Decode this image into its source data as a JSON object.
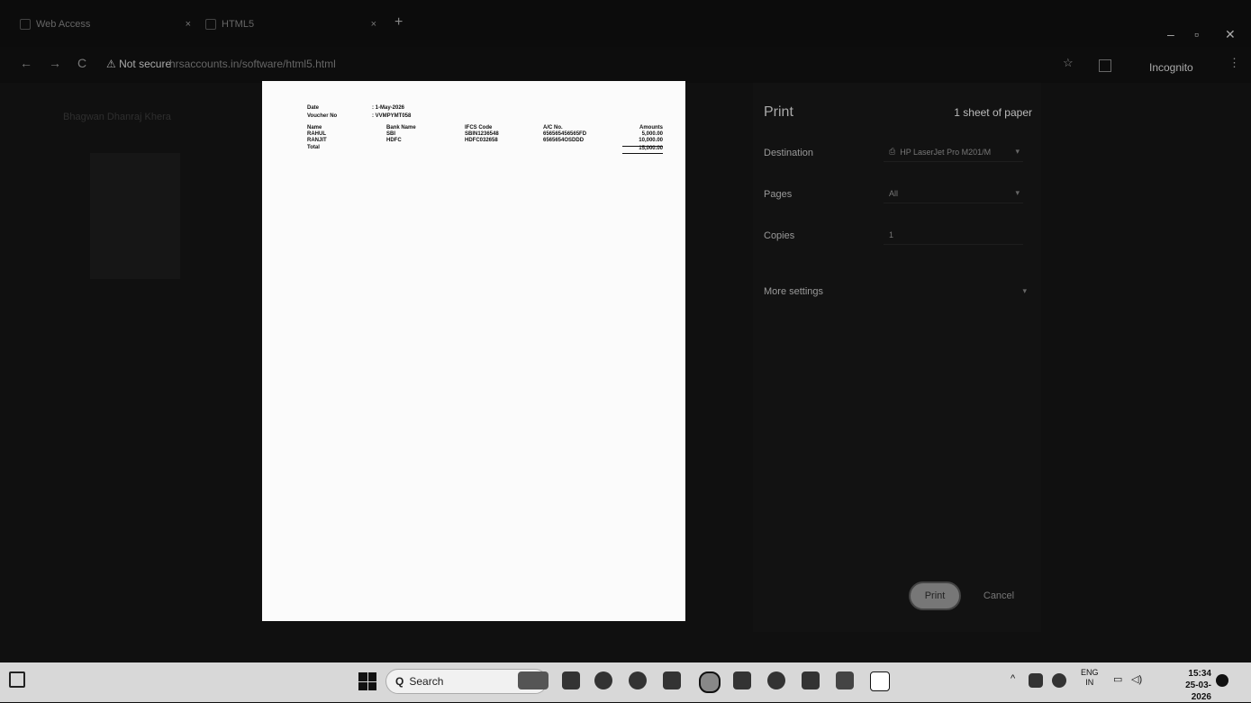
{
  "browser": {
    "tabs": [
      {
        "label": "Web Access",
        "close": "×"
      },
      {
        "label": "HTML5",
        "close": "×"
      }
    ],
    "new_tab": "+",
    "window_controls": [
      "–",
      "▫",
      "✕"
    ],
    "nav": {
      "back": "←",
      "forward": "→",
      "reload": "C"
    },
    "security_label": "⚠ Not secure",
    "url": "hrsaccounts.in/software/html5.html",
    "incognito_label": "Incognito",
    "star": "☆",
    "menu": "⋮"
  },
  "sidebar": {
    "title": "Bhagwan Dhanraj Khera"
  },
  "voucher": {
    "date_label": "Date",
    "date_value": ": 1-May-2026",
    "voucher_label": "Voucher No",
    "voucher_value": ": VVMPYMT058",
    "headers": [
      "Name",
      "Bank Name",
      "IFCS Code",
      "A/C No.",
      "Amounts"
    ],
    "rows": [
      [
        "RAHUL",
        "SBI",
        "SBIN1236548",
        "656565456565FD",
        "5,000.00"
      ],
      [
        "RANJIT",
        "HDFC",
        "HDFC032658",
        "6565654OSDDD",
        "10,000.00"
      ]
    ],
    "total_label": "Total",
    "total_value": "15,000.00"
  },
  "print_panel": {
    "title": "Print",
    "sheets": "1 sheet of paper",
    "destination_label": "Destination",
    "destination_value": "HP LaserJet Pro M201/M",
    "pages_label": "Pages",
    "pages_value": "All",
    "copies_label": "Copies",
    "copies_value": "1",
    "more_settings_label": "More settings",
    "print_button": "Print",
    "cancel_button": "Cancel"
  },
  "taskbar": {
    "search_placeholder": "Search",
    "lang_top": "ENG",
    "lang_bottom": "IN",
    "time": "15:34",
    "date": "25-03-2026",
    "tray_chevron": "^"
  }
}
